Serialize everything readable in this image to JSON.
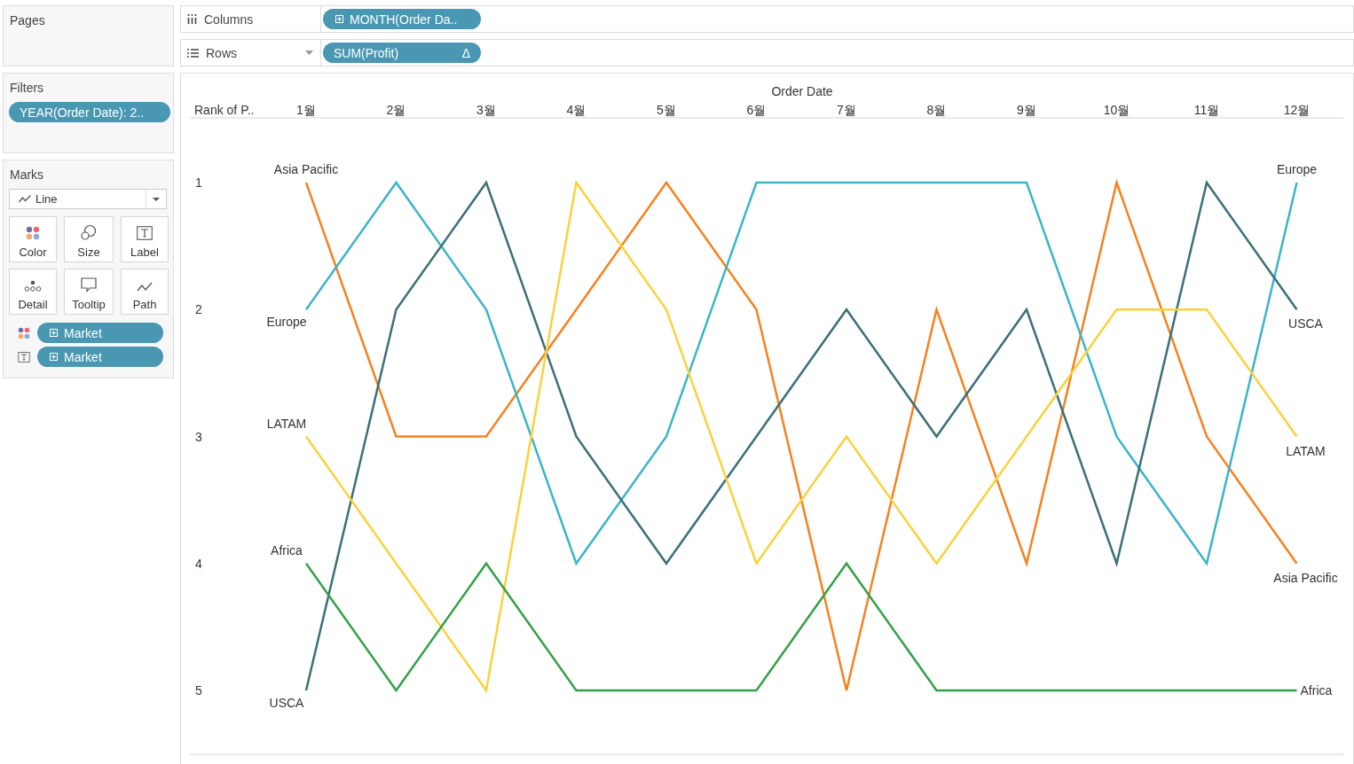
{
  "pages": {
    "title": "Pages"
  },
  "shelves": [
    {
      "kind": "columns",
      "label": "Columns",
      "pill": {
        "kind": "dimension",
        "text": "MONTH(Order Da.."
      }
    },
    {
      "kind": "rows",
      "label": "Rows",
      "pill": {
        "kind": "measure",
        "text": "SUM(Profit)",
        "badge": "Δ"
      }
    }
  ],
  "filters": {
    "title": "Filters",
    "pills": [
      "YEAR(Order Date): 2.."
    ]
  },
  "marks": {
    "title": "Marks",
    "mark_type": "Line",
    "cards": [
      {
        "kind": "color",
        "label": "Color"
      },
      {
        "kind": "size",
        "label": "Size"
      },
      {
        "kind": "label",
        "label": "Label"
      },
      {
        "kind": "detail",
        "label": "Detail"
      },
      {
        "kind": "tooltip",
        "label": "Tooltip"
      },
      {
        "kind": "path",
        "label": "Path"
      }
    ],
    "fields": [
      {
        "kind": "color",
        "label": "Market"
      },
      {
        "kind": "label",
        "label": "Market"
      }
    ]
  },
  "chart": {
    "chart_data": {
      "type": "line",
      "xlabel": "Order Date",
      "ylabel": "Rank of P..",
      "categories": [
        "1월",
        "2월",
        "3월",
        "4월",
        "5월",
        "6월",
        "7월",
        "8월",
        "9월",
        "10월",
        "11월",
        "12월"
      ],
      "yticks": [
        1,
        2,
        3,
        4,
        5
      ],
      "ylim": [
        5,
        1
      ],
      "series": [
        {
          "name": "Asia Pacific",
          "color": "#f5821f",
          "values": [
            1,
            3,
            3,
            2,
            1,
            2,
            5,
            2,
            4,
            1,
            3,
            4
          ]
        },
        {
          "name": "Europe",
          "color": "#3cb4c9",
          "values": [
            2,
            1,
            2,
            4,
            3,
            1,
            1,
            1,
            1,
            3,
            4,
            1
          ]
        },
        {
          "name": "USCA",
          "color": "#3c6f76",
          "values": [
            5,
            2,
            1,
            3,
            4,
            3,
            2,
            3,
            2,
            4,
            1,
            2
          ]
        },
        {
          "name": "LATAM",
          "color": "#f8d23e",
          "values": [
            3,
            4,
            5,
            1,
            2,
            4,
            3,
            4,
            3,
            2,
            2,
            3
          ]
        },
        {
          "name": "Africa",
          "color": "#34a047",
          "values": [
            4,
            5,
            4,
            5,
            5,
            5,
            4,
            5,
            5,
            5,
            5,
            5
          ]
        }
      ]
    }
  }
}
